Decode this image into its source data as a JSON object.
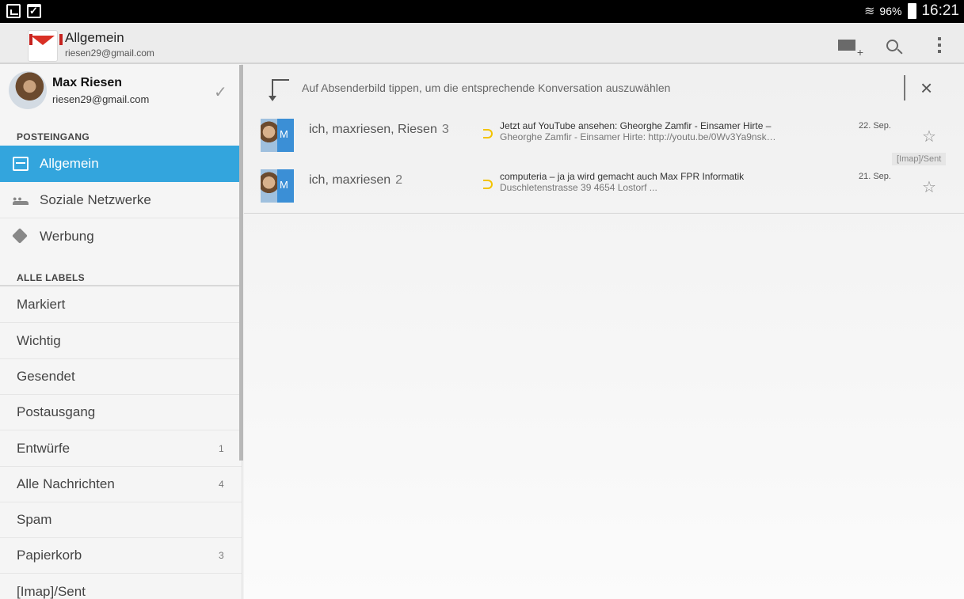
{
  "statusbar": {
    "battery": "96%",
    "time": "16:21"
  },
  "actionbar": {
    "title": "Allgemein",
    "account": "riesen29@gmail.com"
  },
  "account": {
    "name": "Max Riesen",
    "email": "riesen29@gmail.com"
  },
  "sections": {
    "inbox": "POSTEINGANG",
    "labels": "ALLE LABELS"
  },
  "inbox_items": [
    {
      "label": "Allgemein",
      "icon": "inbox-icon"
    },
    {
      "label": "Soziale Netzwerke",
      "icon": "people-icon"
    },
    {
      "label": "Werbung",
      "icon": "tag-icon"
    }
  ],
  "labels": [
    {
      "label": "Markiert",
      "count": ""
    },
    {
      "label": "Wichtig",
      "count": ""
    },
    {
      "label": "Gesendet",
      "count": ""
    },
    {
      "label": "Postausgang",
      "count": ""
    },
    {
      "label": "Entwürfe",
      "count": "1"
    },
    {
      "label": "Alle Nachrichten",
      "count": "4"
    },
    {
      "label": "Spam",
      "count": ""
    },
    {
      "label": "Papierkorb",
      "count": "3"
    },
    {
      "label": "[Imap]/Sent",
      "count": ""
    }
  ],
  "hint": {
    "text": "Auf Absenderbild tippen, um die entsprechende Konversation auszuwählen"
  },
  "conversations": [
    {
      "avatar_letter": "M",
      "senders": "ich, maxriesen, Riesen",
      "count": "3",
      "subject": "Jetzt auf YouTube ansehen: Gheorghe Zamfir - Einsamer Hirte –",
      "snippet": "Gheorghe Zamfir - Einsamer Hirte: http://youtu.be/0Wv3Ya9nsk…",
      "date": "22. Sep.",
      "label": "[Imap]/Sent"
    },
    {
      "avatar_letter": "M",
      "senders": "ich, maxriesen",
      "count": "2",
      "subject": "computeria – ja ja wird gemacht auch Max FPR Informatik",
      "snippet": "Duschletenstrasse 39 4654 Lostorf ...",
      "date": "21. Sep.",
      "label": ""
    }
  ],
  "colors": {
    "accent": "#33a5dd",
    "gmail_red": "#d93025",
    "important": "#f3c300"
  }
}
